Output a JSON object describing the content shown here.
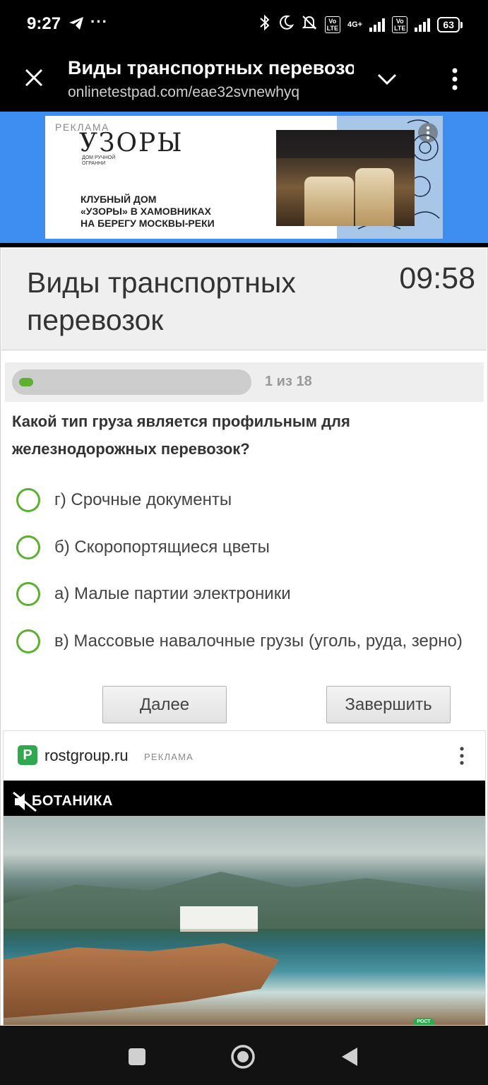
{
  "status_bar": {
    "time": "9:27",
    "dots": "···",
    "volte_1": "Vo\nLTE",
    "network": "4G+",
    "volte_2": "Vo\nLTE",
    "battery": "63"
  },
  "browser": {
    "title": "Виды транспортных перевозо",
    "url": "onlinetestpad.com/eae32svnewhyq"
  },
  "ad_top": {
    "label": "РЕКЛАМА",
    "brand": "УЗОРЫ",
    "brand_sub": "ДОМ РУЧНОЙ ОГРАННИ",
    "copy_line1": "КЛУБНЫЙ ДОМ",
    "copy_line2": "«УЗОРЫ» В ХАМОВНИКАХ",
    "copy_line3": "НА БЕРЕГУ МОСКВЫ-РЕКИ"
  },
  "test": {
    "title": "Виды транспортных перевозок",
    "timer": "09:58",
    "progress_text": "1 из 18",
    "progress_fraction": 0.0556,
    "question": "Какой тип груза является профильным для железнодорожных перевозок?",
    "options": [
      "г) Срочные документы",
      "б) Скоропортящиеся цветы",
      "а) Малые партии электроники",
      "в) Массовые навалочные грузы (уголь, руда, зерно)"
    ],
    "next_button": "Далее",
    "finish_button": "Завершить"
  },
  "ad_bottom": {
    "logo_letter": "P",
    "domain": "rostgroup.ru",
    "label": "РЕКЛАМА",
    "video_brand": "БОТАНИКА",
    "badge": "РОСТ"
  },
  "colors": {
    "accent_green": "#5cb030",
    "ad_blue": "#3d8ef0",
    "header_gray": "#efefef"
  }
}
